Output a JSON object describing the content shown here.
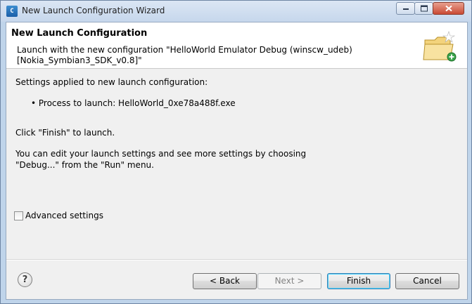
{
  "window": {
    "title": "New Launch Configuration Wizard",
    "app_icon_letter": "C"
  },
  "header": {
    "title": "New Launch Configuration",
    "description": "Launch with the new configuration \"HelloWorld Emulator Debug (winscw_udeb) [Nokia_Symbian3_SDK_v0.8]\""
  },
  "content": {
    "settings_heading": "Settings applied to new launch configuration:",
    "process_line": "• Process to launch: HelloWorld_0xe78a488f.exe",
    "finish_hint": "Click \"Finish\" to launch.",
    "edit_hint_1": "You can edit your launch settings and see more settings by choosing",
    "edit_hint_2": "\"Debug...\" from the \"Run\" menu."
  },
  "advanced": {
    "label": "Advanced settings",
    "checked": false
  },
  "buttons": {
    "help": "?",
    "back": "< Back",
    "next": "Next >",
    "finish": "Finish",
    "cancel": "Cancel"
  },
  "colors": {
    "frame": "#bfd4ea",
    "dialog_bg": "#f0f0f0",
    "close_button": "#c94a34",
    "default_button_focus": "#3c7fb1"
  },
  "icons": [
    "app-icon",
    "minimize-icon",
    "maximize-icon",
    "close-icon",
    "folder-wizard-icon",
    "help-icon"
  ]
}
